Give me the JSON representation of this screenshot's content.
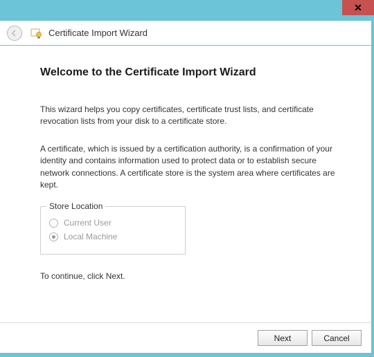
{
  "titlebar": {
    "close": "✕"
  },
  "header": {
    "title": "Certificate Import Wizard"
  },
  "content": {
    "heading": "Welcome to the Certificate Import Wizard",
    "para1": "This wizard helps you copy certificates, certificate trust lists, and certificate revocation lists from your disk to a certificate store.",
    "para2": "A certificate, which is issued by a certification authority, is a confirmation of your identity and contains information used to protect data or to establish secure network connections. A certificate store is the system area where certificates are kept.",
    "store": {
      "legend": "Store Location",
      "options": [
        {
          "label": "Current User",
          "selected": false
        },
        {
          "label": "Local Machine",
          "selected": true
        }
      ]
    },
    "continue": "To continue, click Next."
  },
  "buttons": {
    "next": "Next",
    "cancel": "Cancel"
  }
}
